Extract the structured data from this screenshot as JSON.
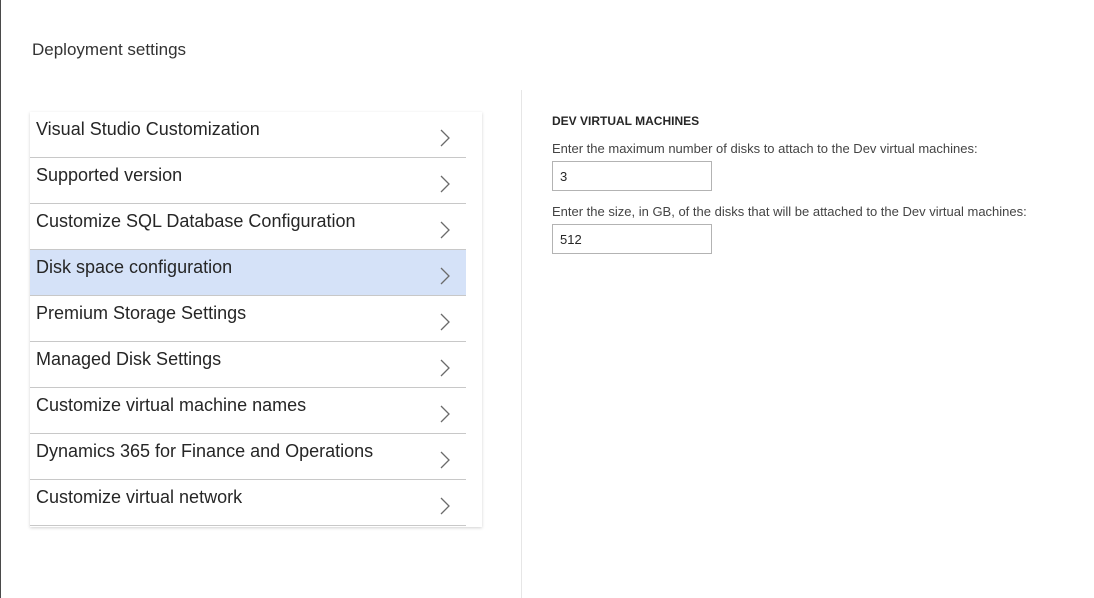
{
  "page": {
    "title": "Deployment settings"
  },
  "settings_menu": {
    "items": [
      {
        "label": "Visual Studio Customization",
        "selected": false
      },
      {
        "label": "Supported version",
        "selected": false
      },
      {
        "label": "Customize SQL Database Configuration",
        "selected": false
      },
      {
        "label": "Disk space configuration",
        "selected": true
      },
      {
        "label": "Premium Storage Settings",
        "selected": false
      },
      {
        "label": "Managed Disk Settings",
        "selected": false
      },
      {
        "label": "Customize virtual machine names",
        "selected": false
      },
      {
        "label": "Dynamics 365 for Finance and Operations",
        "selected": false
      },
      {
        "label": "Customize virtual network",
        "selected": false
      }
    ],
    "chevron_icon": "chevron-right-icon",
    "selected_color": "#d5e2f8"
  },
  "details": {
    "heading": "DEV VIRTUAL MACHINES",
    "fields": [
      {
        "label": "Enter the maximum number of disks to attach to the Dev virtual machines:",
        "value": "3"
      },
      {
        "label": "Enter the size, in GB, of the disks that will be attached to the Dev virtual machines:",
        "value": "512"
      }
    ]
  }
}
